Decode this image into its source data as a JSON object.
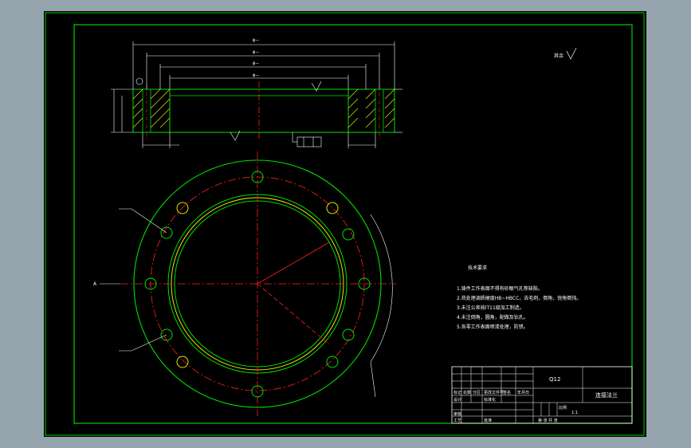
{
  "colors": {
    "background": "#95a3ad",
    "sheet": "#000000",
    "frame": "#00d000",
    "part": "#00e000",
    "dim": "#ffffff",
    "center": "#ff2020",
    "hatch": "#e8e800"
  },
  "drawing": {
    "top_dims": [
      "ϕ—",
      "ϕ—",
      "ϕ—",
      "ϕ—"
    ],
    "surface_note": "其余",
    "side_label": "A"
  },
  "notes": {
    "title": "技术要求",
    "items": [
      "1.铸件工作表面不得有砂眼气孔等缺陷。",
      "2.热处理调质硬度HB~HBCC，去毛刺，倒角，锐角倒钝。",
      "3.未注公差按IT11级加工制造。",
      "4.未注倒角，圆角，配做及钻孔。",
      "5.各零工作表面喷漆处理，防锈。"
    ]
  },
  "title_block": {
    "material": "Q12",
    "part_name": "连接法兰",
    "scale_label": "比例",
    "scale_value": "1:1",
    "labels": [
      "标记",
      "处数",
      "分区",
      "更改文件号",
      "签名",
      "年月日",
      "设计",
      "标准化",
      "审核",
      "工艺",
      "批准"
    ],
    "bottom_left": "第 张 共 张"
  }
}
